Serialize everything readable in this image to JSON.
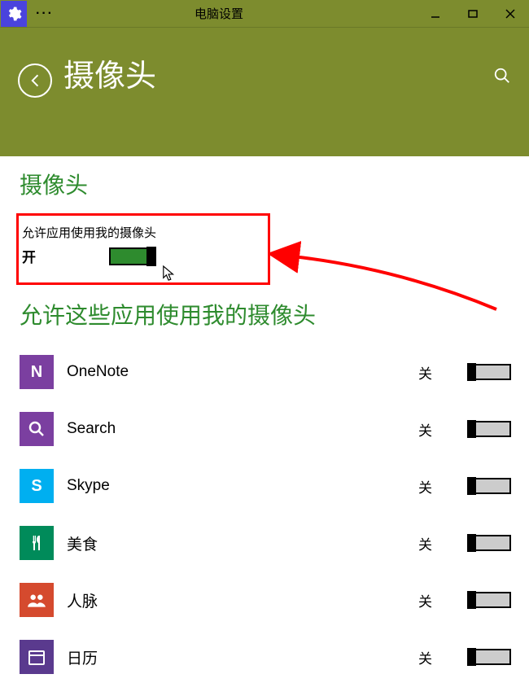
{
  "titlebar": {
    "title": "电脑设置",
    "ellipsis": "···"
  },
  "header": {
    "page_title": "摄像头"
  },
  "main": {
    "section_title": "摄像头",
    "permission_label": "允许应用使用我的摄像头",
    "permission_state": "开",
    "apps_title": "允许这些应用使用我的摄像头",
    "apps": [
      {
        "name": "OneNote",
        "state": "关",
        "icon_letter": "N",
        "icon_class": "ic-onenote"
      },
      {
        "name": "Search",
        "state": "关",
        "icon_letter": "",
        "icon_class": "ic-search"
      },
      {
        "name": "Skype",
        "state": "关",
        "icon_letter": "S",
        "icon_class": "ic-skype"
      },
      {
        "name": "美食",
        "state": "关",
        "icon_letter": "",
        "icon_class": "ic-food"
      },
      {
        "name": "人脉",
        "state": "关",
        "icon_letter": "",
        "icon_class": "ic-people"
      },
      {
        "name": "日历",
        "state": "关",
        "icon_letter": "",
        "icon_class": "ic-cal"
      }
    ]
  }
}
